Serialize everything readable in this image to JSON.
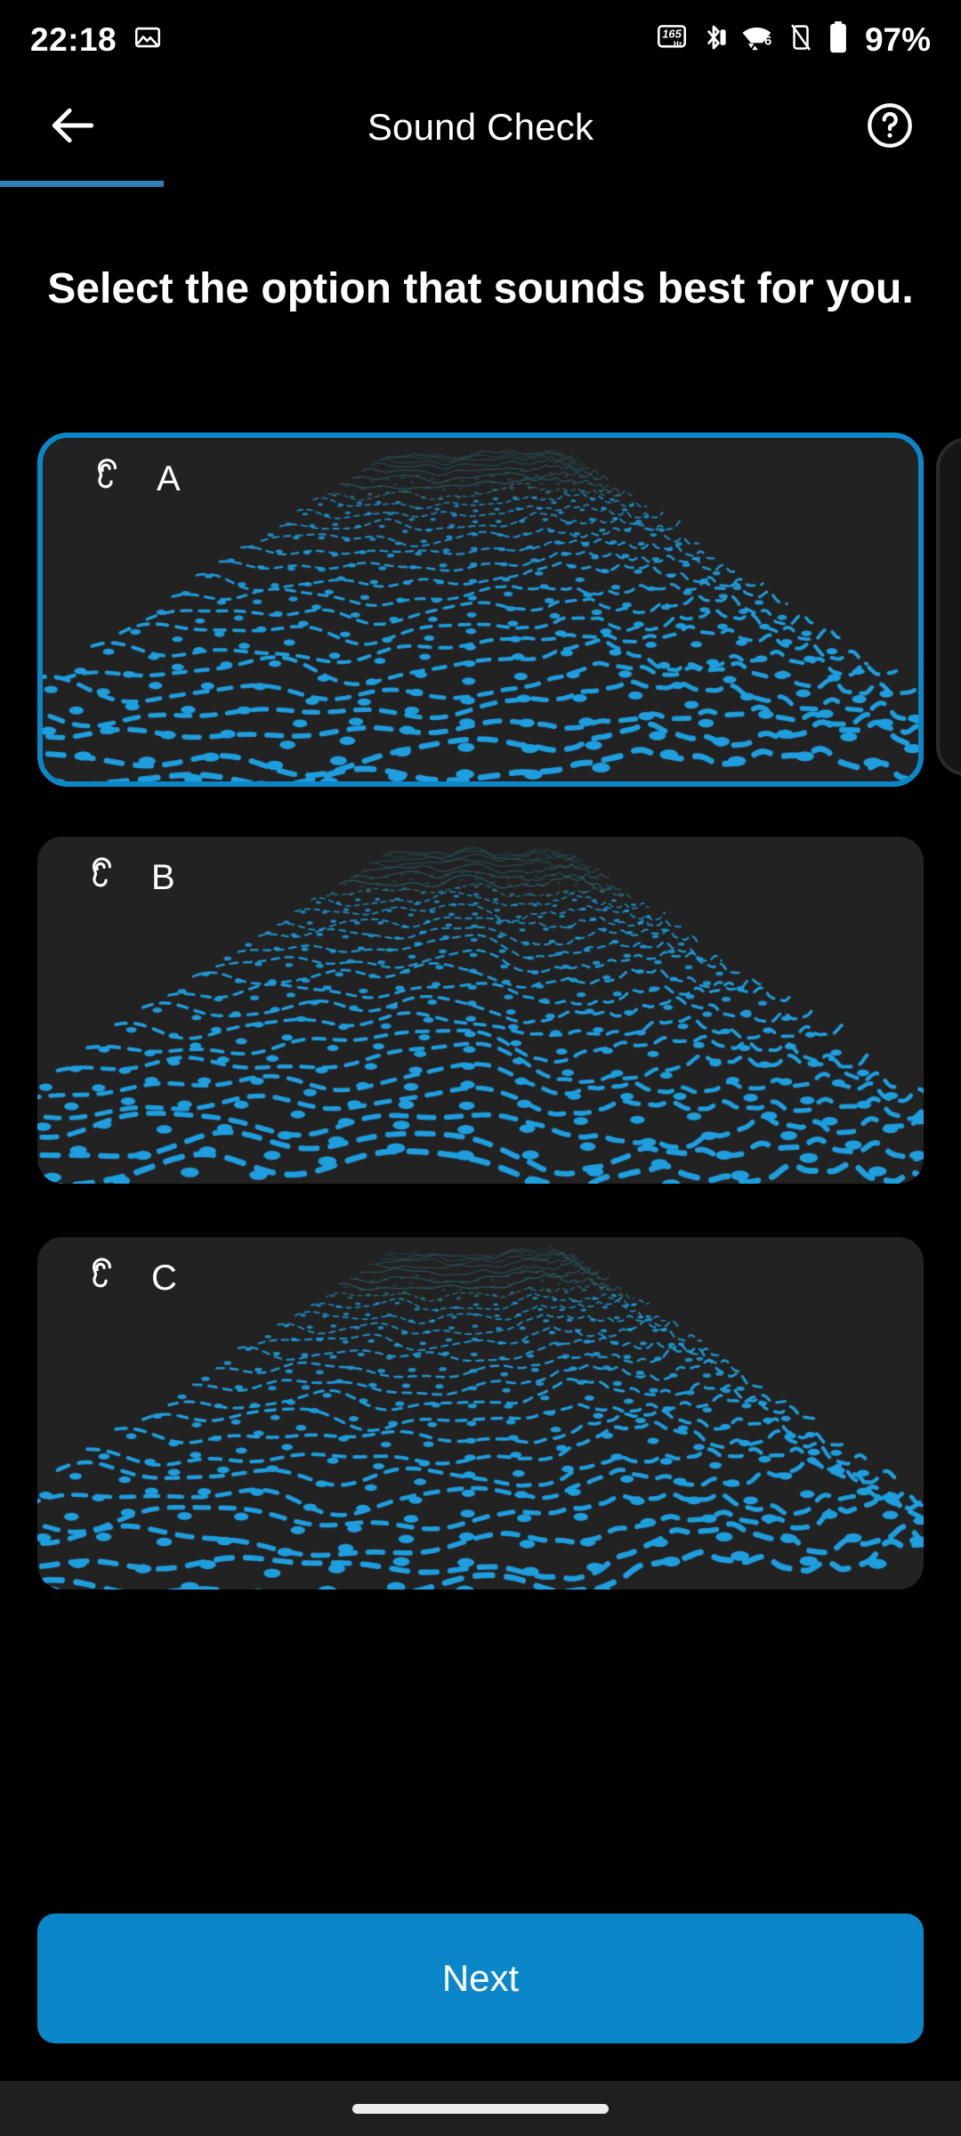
{
  "status_bar": {
    "time": "22:18",
    "battery_percent": "97%",
    "icons": [
      {
        "name": "screenshot-icon",
        "glyph": "image"
      },
      {
        "name": "refresh-rate-165hz-icon",
        "glyph": "165Hz"
      },
      {
        "name": "bluetooth-icon",
        "glyph": "bluetooth"
      },
      {
        "name": "wifi-6-icon",
        "glyph": "wifi6"
      },
      {
        "name": "vibrate-off-icon",
        "glyph": "phone-slash"
      },
      {
        "name": "battery-icon",
        "glyph": "battery"
      }
    ]
  },
  "app_bar": {
    "back_label": "Back",
    "title": "Sound Check",
    "help_label": "Help"
  },
  "progress": {
    "percent": 17,
    "color": "#2f7fb5"
  },
  "headline": "Select the option that sounds best for you.",
  "options": [
    {
      "id": "A",
      "letter": "A",
      "icon": "ear-icon",
      "selected": true,
      "visualization": "audio-landscape-a"
    },
    {
      "id": "B",
      "letter": "B",
      "icon": "ear-icon",
      "selected": false,
      "visualization": "audio-landscape-b"
    },
    {
      "id": "C",
      "letter": "C",
      "icon": "ear-icon",
      "selected": false,
      "visualization": "audio-landscape-c"
    }
  ],
  "primary_action": {
    "label": "Next"
  },
  "colors": {
    "accent": "#0b87c9",
    "selected_border": "#0b87c9",
    "card_bg": "#222222",
    "page_bg": "#000000",
    "text": "#ffffff",
    "wave_bright": "#1f9ede",
    "wave_dim": "#2f7a86"
  },
  "nav_bar": {
    "gesture_pill": "home-gesture-pill"
  }
}
